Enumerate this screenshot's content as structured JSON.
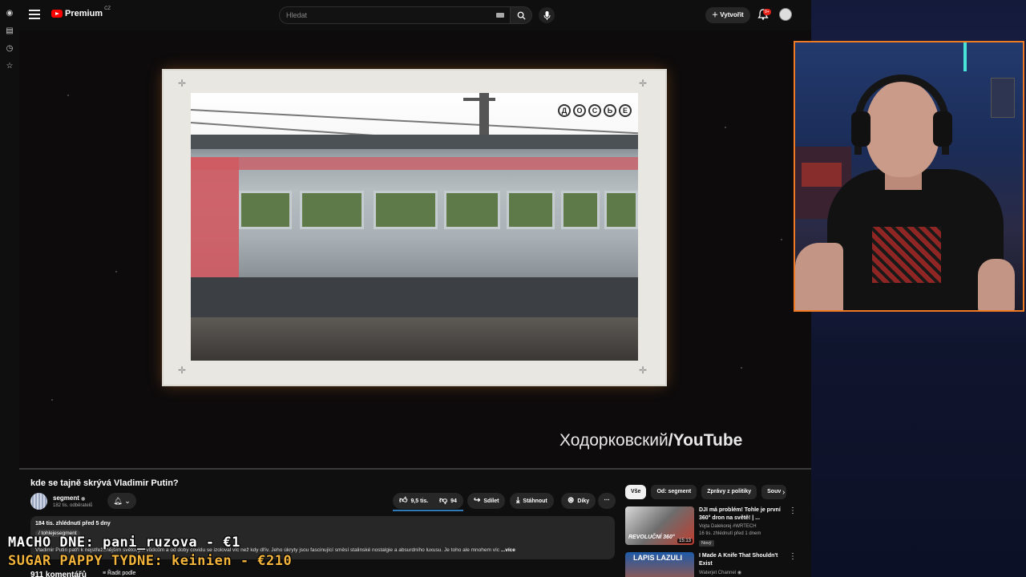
{
  "browser": {
    "brand": "Premium",
    "country": "CZ",
    "search_placeholder": "Hledat",
    "create_label": "Vytvořit",
    "notif_count": "9+"
  },
  "video": {
    "watermark_a": "Ходорковский",
    "watermark_b": "/YouTube",
    "dossier_letters": [
      "Д",
      "О",
      "С",
      "Ь",
      "Е"
    ],
    "title": "kde se tajně skrývá Vladimir Putin?",
    "channel": "segment",
    "subscribers": "182 tis. odběratelů",
    "likes": "9,5 tis.",
    "dislikes": "94",
    "share_label": "Sdílet",
    "download_label": "Stáhnout",
    "thanks_label": "Díky",
    "meta": "184 tis. zhlédnutí  před 5 dny",
    "tag": "/ tohlejesegment",
    "description": "Vladimir Putin patří k nejstřeženějším světovým vůdcům a od doby covidu se izoloval víc než kdy dřív. Jeho úkryty jsou fascinující směsí stalinské nostalgie a absurdního luxusu. Je toho ale mnohem víc",
    "more_label": "...více",
    "comments": "911 komentářů",
    "sort_label": "Řadit podle"
  },
  "sidebar": {
    "chips": [
      "Vše",
      "Od: segment",
      "Zprávy z politiky",
      "Souv"
    ],
    "recommendations": [
      {
        "title": "DJI má problém! Tohle je první 360° dron na světě! | ...",
        "channel": "Vojta Dalekorej #WRTECH",
        "views": "16 tis. zhlédnutí  před 1 dnem",
        "badge": "Nový",
        "duration": "15:13",
        "thumb_text": "REVOLUČNÍ 360°"
      },
      {
        "title": "I Made A Knife That Shouldn't Exist",
        "channel": "Waterjet Channel",
        "views": "",
        "badge": "",
        "duration": "",
        "thumb_text": "LAPIS LAZULI"
      }
    ]
  },
  "overlay": {
    "line1": "MACHO DNE: pani_ruzova - €1",
    "line2": "SUGAR PAPPY TYDNE: keinien - €210"
  },
  "colors": {
    "accent": "#ff0000",
    "cam_border": "#f07a22",
    "overlay_gold": "#f3b43c"
  }
}
